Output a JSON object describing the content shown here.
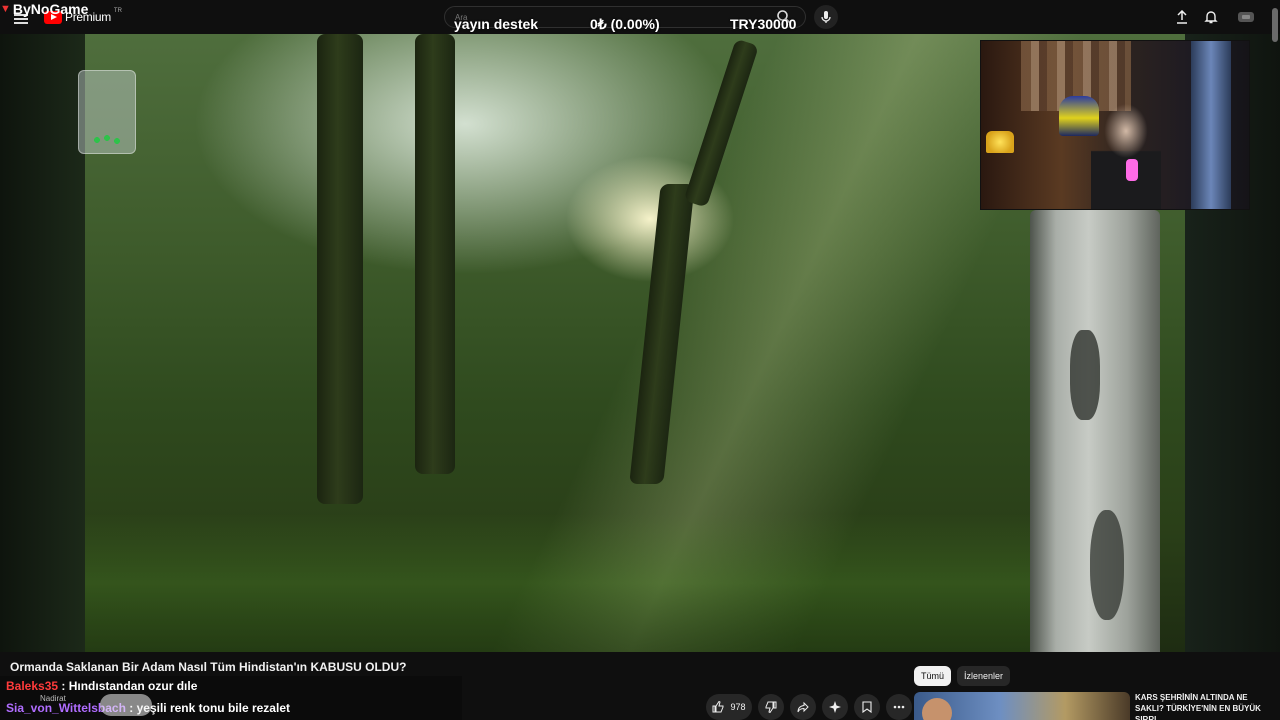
{
  "overlay": {
    "brand": "ByNoGame"
  },
  "header": {
    "logo_word": "Premium",
    "logo_country": "TR",
    "search_placeholder": "Ara"
  },
  "donation": {
    "label": "yayın destek",
    "progress": "0₺ (0.00%)",
    "goal": "TRY30000",
    "progress_fraction": 0
  },
  "video": {
    "title": "Ormanda Saklanan Bir Adam Nasıl Tüm Hindistan'ın KABUSU OLDU?"
  },
  "chat": [
    {
      "user": "Baleks35",
      "message": " : Hındıstandan ozur dıle"
    },
    {
      "user": "Sia_von_Wittelsbach",
      "message": " : yeşili renk tonu bile rezalet"
    }
  ],
  "channel_ghost": "Nadirat",
  "actions": {
    "like_count": "978"
  },
  "chips": [
    "Tümü",
    "İzlenenler"
  ],
  "recommendation": {
    "title": "KARS ŞEHRİNİN ALTINDA NE SAKLI? TÜRKİYE'NİN EN BÜYÜK SIRRI"
  },
  "colors": {
    "background": "#0f0f0f",
    "chat_user1": "#ff3b3b",
    "chat_user2": "#b06dff",
    "brand_red": "#ff0000"
  }
}
